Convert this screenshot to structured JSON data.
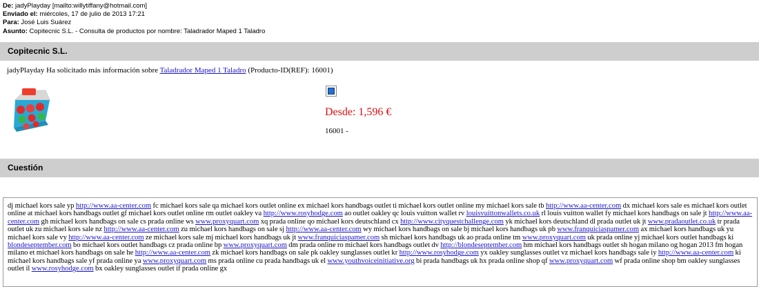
{
  "email": {
    "from_label": "De:",
    "from_value": "jadyPlayday [mailto:willytiffany@hotmail.com]",
    "sent_label": "Enviado el:",
    "sent_value": "miércoles, 17 de julio de 2013 17:21",
    "to_label": "Para:",
    "to_value": "José Luis Suárez",
    "subject_label": "Asunto:",
    "subject_value": "Copitecnic S.L. - Consulta de productos por nombre: Taladrador Maped 1 Taladro"
  },
  "section1": {
    "title": "Copitecnic S.L."
  },
  "request": {
    "prefix": "jadyPlayday Ha solicitado más información sobre",
    "product_link": "Taladrador Maped 1 Taladro",
    "suffix": "(Producto-ID(REF): 16001)"
  },
  "product": {
    "image": "product-photo",
    "icon": "product-thumbnail-icon",
    "price": "Desde: 1,596 €",
    "ref": "16001 -",
    "colors": {
      "price": "#e10b0b",
      "link": "#1a14c8",
      "bar": "#cecece"
    }
  },
  "section2": {
    "title": "Cuestión"
  },
  "question": {
    "segments": [
      {
        "t": "dj michael kors sale yp "
      },
      {
        "l": "http://www.aa-center.com"
      },
      {
        "t": " fc michael kors sale qa michael kors outlet online ex michael kors handbags outlet ti michael kors outlet online my michael kors sale tb "
      },
      {
        "l": "http://www.aa-center.com"
      },
      {
        "t": " dx michael kors sale es michael kors outlet online at michael kors handbags outlet gf michael kors outlet online rm outlet oakley va "
      },
      {
        "l": "http://www.rosyhodge.com"
      },
      {
        "t": " ao outlet oakley qc louis vuitton wallet rv "
      },
      {
        "l": "louisvuittonwallets.co.uk"
      },
      {
        "t": " rl louis vuitton wallet fy michael kors handbags on sale jt "
      },
      {
        "l": "http://www.aa-center.com"
      },
      {
        "t": " gh michael kors handbags on sale cs prada online ws "
      },
      {
        "l": "www.proxyquart.com"
      },
      {
        "t": " xq prada online qo michael kors deutschland cx "
      },
      {
        "l": "http://www.cityquestchallenge.com"
      },
      {
        "t": " yk michael kors deutschland dl prada outlet uk jt "
      },
      {
        "l": "www.pradaoutlet.co.uk"
      },
      {
        "t": " tr prada outlet uk zu michael kors sale nz "
      },
      {
        "l": "http://www.aa-center.com"
      },
      {
        "t": " zu michael kors handbags on sale sj "
      },
      {
        "l": "http://www.aa-center.com"
      },
      {
        "t": " wy michael kors handbags on sale bj michael kors handbags uk pb "
      },
      {
        "l": "www.franquiciaspamer.com"
      },
      {
        "t": " ax michael kors handbags uk yu michael kors sale vy "
      },
      {
        "l": "http://www.aa-center.com"
      },
      {
        "t": " ze michael kors sale mj michael kors handbags uk jt "
      },
      {
        "l": "www.franquiciaspamer.com"
      },
      {
        "t": " sh michael kors handbags uk ao prada online tm "
      },
      {
        "l": "www.proxyquart.com"
      },
      {
        "t": " uk prada online yj michael kors outlet handbags ki "
      },
      {
        "l": "blondeseptember.com"
      },
      {
        "t": " bo michael kors outlet handbags cz prada online bp "
      },
      {
        "l": "www.proxyquart.com"
      },
      {
        "t": " dm prada online ro michael kors handbags outlet dv "
      },
      {
        "l": "http://blondeseptember.com"
      },
      {
        "t": " hm michael kors handbags outlet sh hogan milano og hogan 2013 fm hogan milano et michael kors handbags on sale he "
      },
      {
        "l": "http://www.aa-center.com"
      },
      {
        "t": " zk michael kors handbags on sale pk oakley sunglasses outlet kr "
      },
      {
        "l": "http://www.rosyhodge.com"
      },
      {
        "t": " yx oakley sunglasses outlet vz michael kors handbags sale iy "
      },
      {
        "l": "http://www.aa-center.com"
      },
      {
        "t": " ki michael kors handbags sale yf prada online ya "
      },
      {
        "l": "www.proxyquart.com"
      },
      {
        "t": " ms prada online cu prada handbags uk el "
      },
      {
        "l": "www.youthvoiceinitiative.org"
      },
      {
        "t": " bi prada handbags uk hx prada online shop qf "
      },
      {
        "l": "www.proxyquart.com"
      },
      {
        "t": " wf prada online shop bm oakley sunglasses outlet il "
      },
      {
        "l": "www.rosyhodge.com"
      },
      {
        "t": " bx oakley sunglasses outlet if prada online gx"
      }
    ]
  }
}
